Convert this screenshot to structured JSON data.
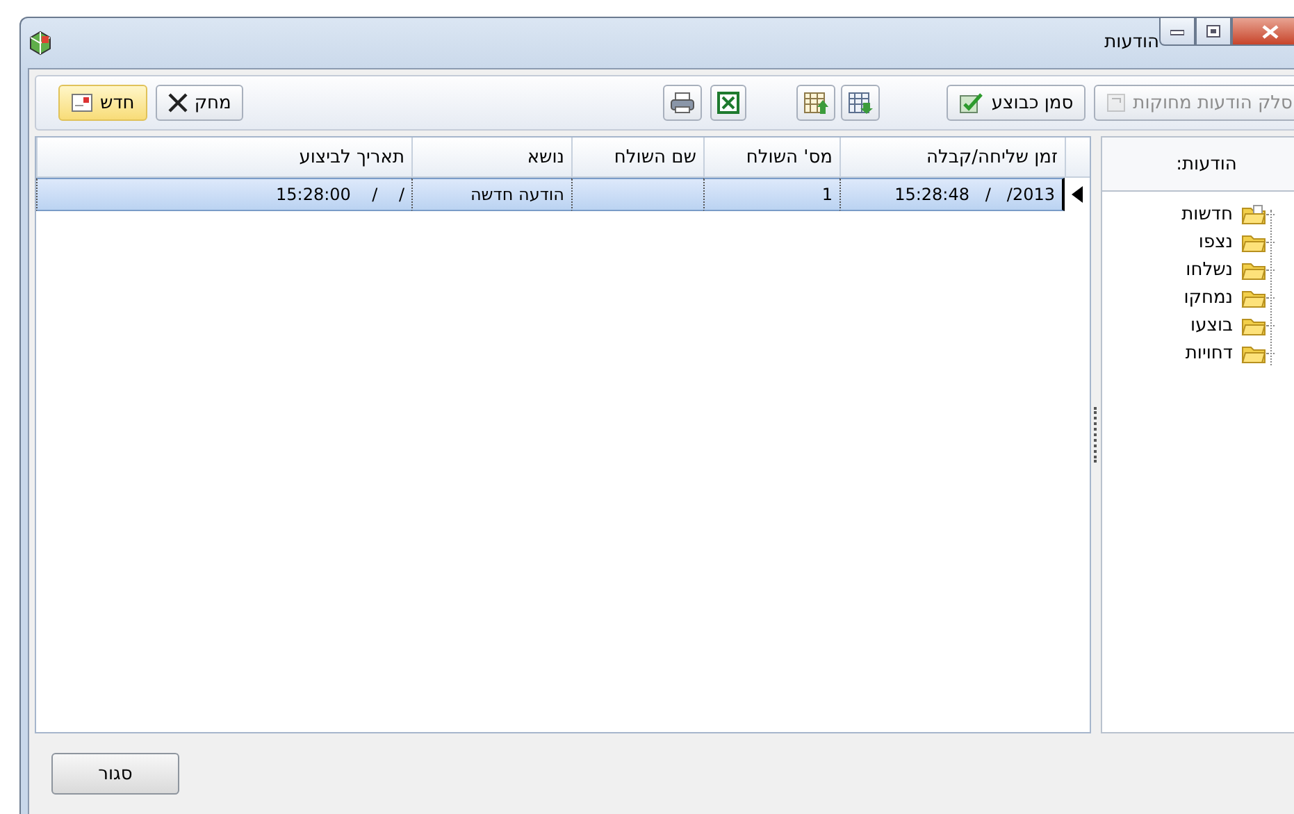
{
  "window": {
    "title": "הודעות"
  },
  "toolbar": {
    "groups": [
      [
        {
          "kind": "label",
          "label": "סלק הודעות מחוקות",
          "disabled": true,
          "default": false
        },
        {
          "kind": "label",
          "label": "סמן כבוצע",
          "disabled": false,
          "default": false
        }
      ],
      [
        {
          "kind": "table-down",
          "disabled": false,
          "default": false
        },
        {
          "kind": "table-up",
          "disabled": false,
          "default": false
        }
      ],
      [
        {
          "kind": "spreadsheet",
          "disabled": false,
          "default": false
        },
        {
          "kind": "print",
          "disabled": false,
          "default": false
        }
      ],
      [
        {
          "kind": "delete",
          "label": "מחק",
          "disabled": false,
          "default": false
        },
        {
          "kind": "new",
          "label": "חדש",
          "disabled": false,
          "default": true
        }
      ]
    ]
  },
  "sidebar": {
    "title": "הודעות:",
    "items": [
      {
        "label": "חדשות"
      },
      {
        "label": "נצפו"
      },
      {
        "label": "נשלחו"
      },
      {
        "label": "נמחקו"
      },
      {
        "label": "בוצעו"
      },
      {
        "label": "דחויות"
      }
    ]
  },
  "table": {
    "columns": [
      "זמן שליחה/קבלה",
      "מס' השולח",
      "שם השולח",
      "נושא",
      "תאריך לביצוע"
    ],
    "rows": [
      {
        "selected": true,
        "cells": [
          "15:28:48   /   /2013",
          "1",
          "",
          "הודעה חדשה",
          "15:28:00    /    /"
        ]
      }
    ]
  },
  "footer": {
    "button": "סגור"
  }
}
